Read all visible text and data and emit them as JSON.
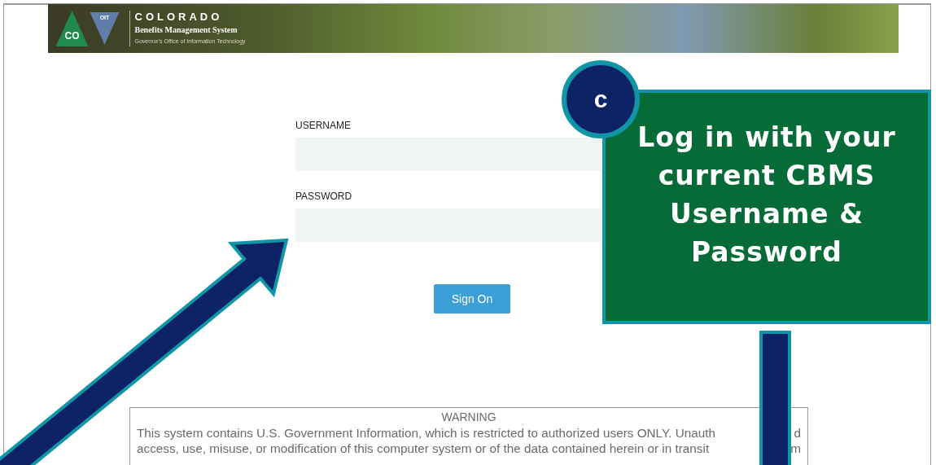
{
  "banner": {
    "logo_left": "CO",
    "logo_right": "OIT",
    "title": "COLORADO",
    "subtitle": "Benefits Management System",
    "tagline": "Governor's Office of Information Technology"
  },
  "form": {
    "username_label": "USERNAME",
    "password_label": "PASSWORD",
    "submit": "Sign On"
  },
  "warning": {
    "heading": "WARNING",
    "lines": [
      [
        "This system contains U.S. Government Information, which is restricted to authorized users ONLY. Unauth",
        "d"
      ],
      [
        "access, use, misuse, or modification of this computer system or of the data contained herein or in transit",
        "m"
      ]
    ]
  },
  "callout": {
    "badge": "c",
    "text": "Log in with your current CBMS Username & Password"
  }
}
